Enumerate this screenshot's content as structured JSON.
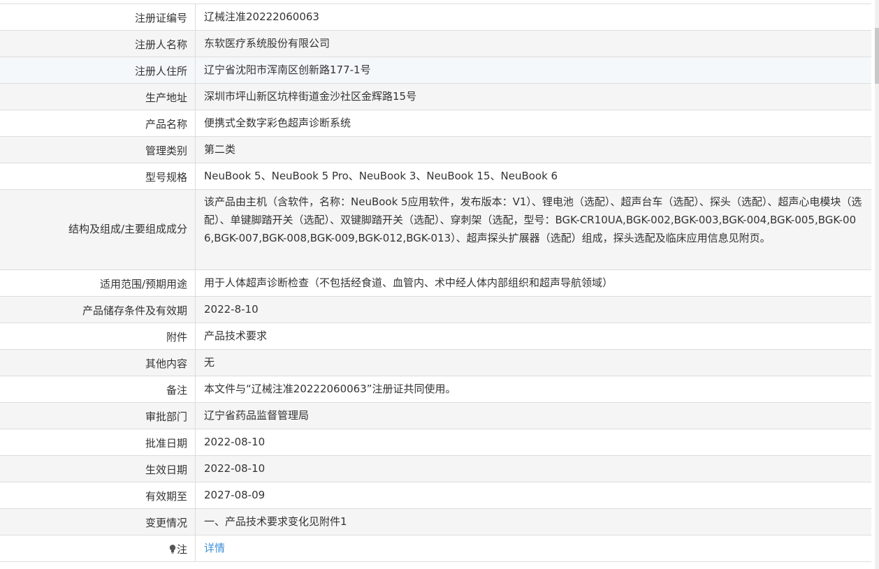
{
  "rows": [
    {
      "label": "注册证编号",
      "value": "辽械注准20222060063"
    },
    {
      "label": "注册人名称",
      "value": "东软医疗系统股份有限公司"
    },
    {
      "label": "注册人住所",
      "value": "辽宁省沈阳市浑南区创新路177-1号"
    },
    {
      "label": "生产地址",
      "value": "深圳市坪山新区坑梓街道金沙社区金辉路15号"
    },
    {
      "label": "产品名称",
      "value": "便携式全数字彩色超声诊断系统"
    },
    {
      "label": "管理类别",
      "value": "第二类"
    },
    {
      "label": "型号规格",
      "value": "NeuBook 5、NeuBook 5 Pro、NeuBook 3、NeuBook 15、NeuBook 6"
    },
    {
      "label": "结构及组成/主要组成成分",
      "value": "该产品由主机（含软件，名称：NeuBook 5应用软件，发布版本：V1）、锂电池（选配）、超声台车（选配）、探头（选配）、超声心电模块（选配）、单键脚踏开关（选配）、双键脚踏开关（选配）、穿刺架（选配，型号：BGK-CR10UA,BGK-002,BGK-003,BGK-004,BGK-005,BGK-006,BGK-007,BGK-008,BGK-009,BGK-012,BGK-013）、超声探头扩展器（选配）组成，探头选配及临床应用信息见附页。"
    },
    {
      "label": "适用范围/预期用途",
      "value": "用于人体超声诊断检查（不包括经食道、血管内、术中经人体内部组织和超声导航领域）"
    },
    {
      "label": "产品储存条件及有效期",
      "value": "2022-8-10"
    },
    {
      "label": "附件",
      "value": "产品技术要求"
    },
    {
      "label": "其他内容",
      "value": "无"
    },
    {
      "label": "备注",
      "value": "本文件与“辽械注准20222060063”注册证共同使用。"
    },
    {
      "label": "审批部门",
      "value": "辽宁省药品监督管理局"
    },
    {
      "label": "批准日期",
      "value": "2022-08-10"
    },
    {
      "label": "生效日期",
      "value": "2022-08-10"
    },
    {
      "label": "有效期至",
      "value": "2027-08-09"
    },
    {
      "label": "变更情况",
      "value": "一、产品技术要求变化见附件1"
    },
    {
      "label": "注",
      "value": "详情",
      "icon": "lightbulb-icon",
      "link_color": "#3b8fd9"
    }
  ]
}
